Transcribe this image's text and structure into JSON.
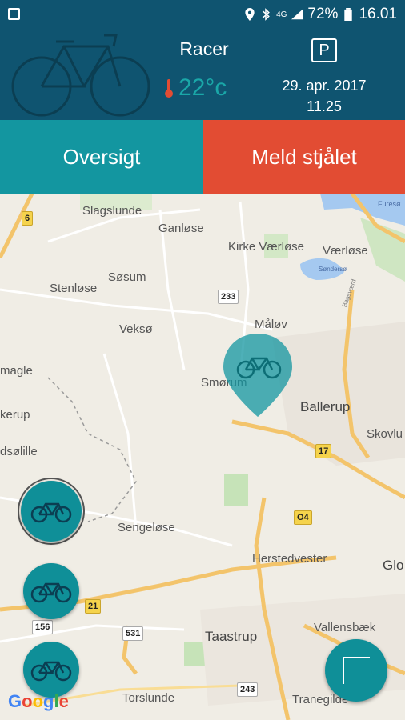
{
  "status_bar": {
    "network": "4G",
    "battery": "72%",
    "time": "16.01"
  },
  "header": {
    "bike_name": "Racer",
    "temperature": "22°c",
    "parking_label": "P",
    "date": "29. apr. 2017",
    "time": "11.25"
  },
  "actions": {
    "overview_label": "Oversigt",
    "report_stolen_label": "Meld stjålet"
  },
  "map": {
    "places": [
      "Slagslunde",
      "Ganløse",
      "Kirke Værløse",
      "Værløse",
      "Søsum",
      "Stenløse",
      "Veksø",
      "Måløv",
      "Smørum",
      "Ballerup",
      "magle",
      "kerup",
      "Skovlu",
      "dsølille",
      "Sengeløse",
      "Herstedvester",
      "Glo",
      "Taastrup",
      "Vallensbæk",
      "Torslunde",
      "Tranegilde",
      "Furesø",
      "Søndersø",
      "Bagsværd"
    ],
    "road_shields": [
      "6",
      "233",
      "17",
      "O4",
      "21",
      "156",
      "531",
      "243"
    ],
    "attribution": "Google"
  },
  "colors": {
    "header_bg": "#0f5470",
    "accent_teal": "#1396a0",
    "report_red": "#e24c33",
    "temp_text": "#1aa7a8"
  },
  "icons": {
    "status_left": "image-icon",
    "location": "location-icon",
    "bluetooth": "bluetooth-icon",
    "signal": "signal-icon",
    "battery": "battery-icon",
    "thermometer": "thermometer-icon",
    "parking": "parking-icon"
  }
}
